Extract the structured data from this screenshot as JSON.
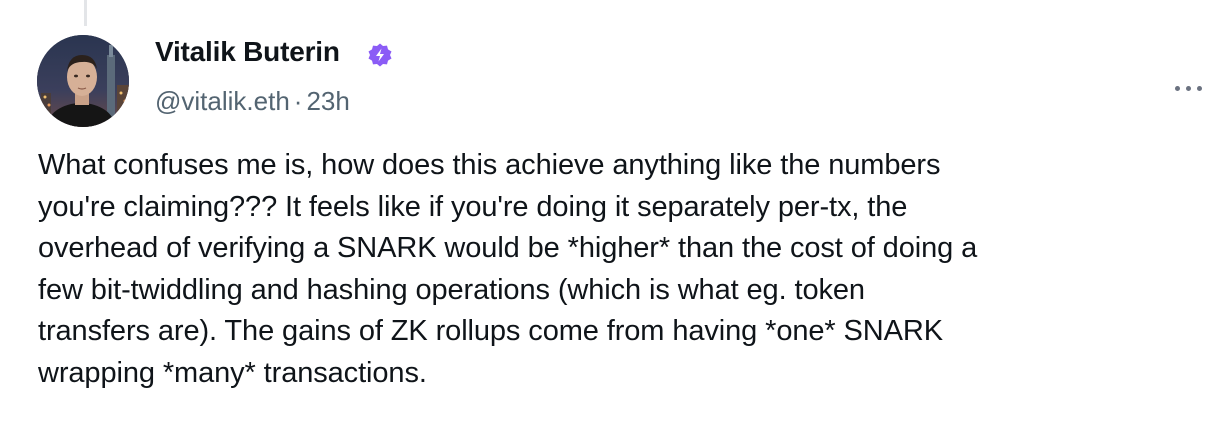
{
  "post": {
    "author": {
      "display_name": "Vitalik Buterin",
      "handle": "@vitalik.eth",
      "verified_badge_icon": "verified-badge-icon",
      "badge_color": "#8b5cf6"
    },
    "meta_separator": "·",
    "timestamp": "23h",
    "more_icon": "more-horizontal-icon",
    "text_lines": [
      "What confuses me is, how does this achieve anything like the numbers",
      "you're claiming??? It feels like if you're doing it separately per-tx, the",
      "overhead of verifying a SNARK would be *higher* than the cost of doing a",
      "few bit-twiddling and hashing operations (which is what eg. token",
      "transfers are). The gains of ZK rollups come from having *one* SNARK",
      "wrapping *many* transactions."
    ]
  },
  "colors": {
    "text_primary": "#0f1419",
    "text_secondary": "#536471",
    "thread_line": "#e3e5e8"
  }
}
